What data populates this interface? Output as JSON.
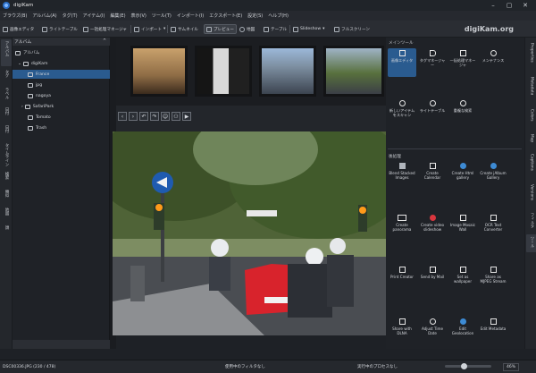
{
  "app": {
    "title": "digiKam",
    "brand": "digiKam.org"
  },
  "menu": [
    "ブラウズ(B)",
    "アルバム(A)",
    "タグ(T)",
    "アイテム(I)",
    "編集(E)",
    "表示(V)",
    "ツール(T)",
    "インポート(I)",
    "エクスポート(E)",
    "設定(S)",
    "ヘルプ(H)"
  ],
  "toolbar": {
    "editor": "画像エディタ",
    "lighttable": "ライトテーブル",
    "batch": "一括処理マネージャ",
    "import": "インポート",
    "thumbnail": "サムネイル",
    "preview": "プレビュー",
    "map": "地図",
    "table": "テーブル",
    "slideshow": "Slideshow",
    "fullscreen": "フルスクリーン"
  },
  "left_tabs": [
    "アルバム",
    "タグ",
    "ラベル",
    "日付",
    "日付",
    "タイムライン",
    "検索",
    "類似",
    "地図",
    "顔"
  ],
  "right_tabs": [
    "Properties",
    "Metadata",
    "Colors",
    "Map",
    "Captions",
    "Versions",
    "フィルタ",
    "ツール"
  ],
  "album": {
    "header": "アルバム",
    "root": "アルバム",
    "collection": "digiKam",
    "items": [
      "France",
      "jpg",
      "nagoya",
      "SafariPark",
      "Tomato",
      "Trash"
    ]
  },
  "tools": {
    "main_header": "メインツール",
    "main": [
      "画像エディタ",
      "タグマネージャー",
      "一括処理マネージャ",
      "メンテナンス",
      "新しいアイテムをスキャン",
      "ライトテーブル",
      "重複な検索"
    ],
    "post_header": "後処理",
    "post": [
      "Blend Stacked Images",
      "Create Calendar",
      "Create Html gallery",
      "Create jAlbum Gallery",
      "Create panorama",
      "Create video slideshow",
      "Image Mosaic Wall",
      "OCR Text Converter",
      "Print Creator",
      "Send by Mail",
      "Set as wallpaper",
      "Share as MJPEG Stream",
      "Share with DLNA",
      "Adjust Time Date",
      "Edit Geolocation",
      "Edit Metadata"
    ]
  },
  "status": {
    "file": "DSC00336.JPG (230 / 478)",
    "filter": "使用中のフィルタなし",
    "process": "実行中のプロセスなし",
    "zoom": "46%"
  },
  "colors": {
    "accent": "#2a5b8f",
    "bg": "#1e2126"
  }
}
